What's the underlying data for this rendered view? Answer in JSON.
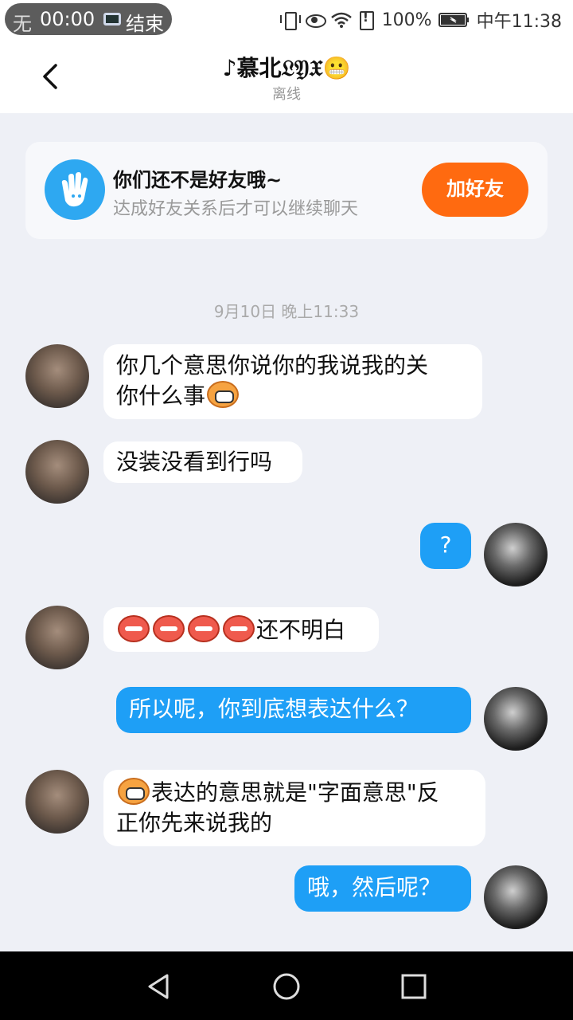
{
  "status_bar": {
    "recorder_ghost": "无",
    "recorder_time": "00:00",
    "recorder_end": "结束",
    "battery": "100%",
    "clock": "中午11:38"
  },
  "header": {
    "title": "♪慕北𝔏𝔜𝔛😬",
    "status": "离线"
  },
  "friend_card": {
    "title": "你们还不是好友哦~",
    "subtitle": "达成好友关系后才可以继续聊天",
    "button": "加好友"
  },
  "chat": {
    "timestamp": "9月10日 晚上11:33",
    "messages": [
      {
        "side": "left",
        "line1": "你几个意思你说你的我说我的关",
        "line2": "你什么事"
      },
      {
        "side": "left",
        "text": "没装没看到行吗"
      },
      {
        "side": "right",
        "text": "?"
      },
      {
        "side": "left",
        "text": "还不明白"
      },
      {
        "side": "right",
        "text": "所以呢，你到底想表达什么？"
      },
      {
        "side": "left",
        "line1": "表达的意思就是\"字面意思\"反",
        "line2": "正你先来说我的"
      },
      {
        "side": "right",
        "text": "哦，然后呢？"
      }
    ]
  },
  "icons": {
    "back": "chevron-left-icon",
    "wave": "waving-hand-icon",
    "nav_back": "triangle-back-icon",
    "nav_home": "circle-home-icon",
    "nav_recent": "square-recent-icon"
  },
  "colors": {
    "accent_blue": "#1e9ff6",
    "add_friend_orange": "#ff6a10"
  }
}
